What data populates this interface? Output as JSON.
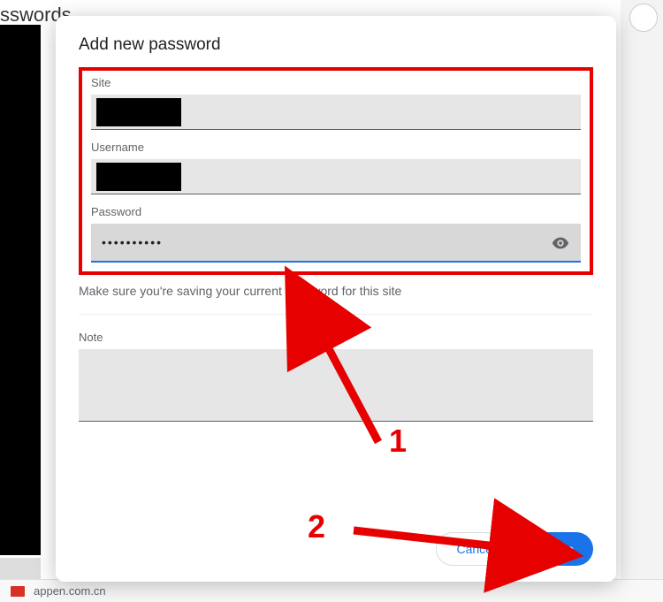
{
  "background": {
    "page_title_partial": "sswords",
    "footer_site": "appen.com.cn"
  },
  "modal": {
    "title": "Add new password",
    "site": {
      "label": "Site",
      "value": ""
    },
    "username": {
      "label": "Username",
      "value": ""
    },
    "password": {
      "label": "Password",
      "value": "••••••••••",
      "show_placeholder": "Show password"
    },
    "helper": "Make sure you're saving your current password for this site",
    "note": {
      "label": "Note",
      "value": ""
    },
    "cancel": "Cancel",
    "save": "Save"
  },
  "annotations": {
    "step1": "1",
    "step2": "2"
  }
}
